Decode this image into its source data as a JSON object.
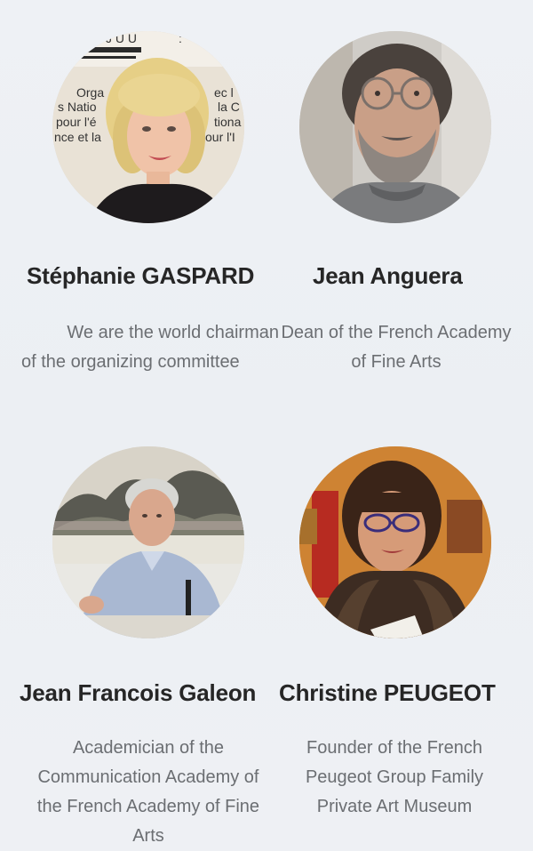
{
  "people": [
    {
      "name": "Stéphanie GASPARD",
      "title_lines": [
        "We are the world chairman",
        "of the organizing committee"
      ],
      "photo_signage": [
        "Orga",
        "s Natio",
        "pour l'é",
        "nce et la",
        "ec l",
        "la C",
        "tiona",
        "our l'I"
      ]
    },
    {
      "name": "Jean Anguera",
      "title_lines": [
        "Dean of the French Academy",
        "of Fine Arts"
      ]
    },
    {
      "name": "Jean Francois Galeon",
      "title_lines": [
        "Academician of the",
        "Communication Academy of",
        "the French Academy of Fine",
        "Arts"
      ]
    },
    {
      "name": "Christine PEUGEOT",
      "title_lines": [
        "Founder of the French",
        "Peugeot Group Family",
        "Private Art Museum"
      ]
    }
  ],
  "colors": {
    "background": "#eef0f4",
    "name_text": "#262626",
    "title_text": "#6b6e72"
  }
}
